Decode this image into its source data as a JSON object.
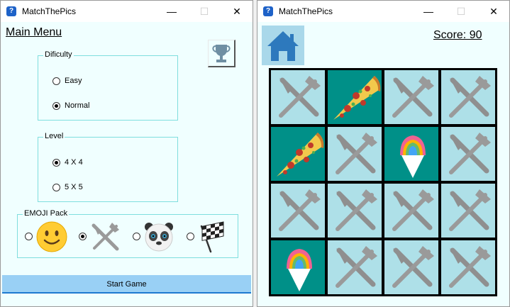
{
  "left_window": {
    "title": "MatchThePics",
    "app_icon_glyph": "?",
    "main_menu_label": "Main Menu",
    "difficulty": {
      "legend": "Dificulty",
      "options": [
        {
          "label": "Easy",
          "checked": false
        },
        {
          "label": "Normal",
          "checked": true
        }
      ]
    },
    "level": {
      "legend": "Level",
      "options": [
        {
          "label": "4 X 4",
          "checked": true
        },
        {
          "label": "5 X 5",
          "checked": false
        }
      ]
    },
    "emoji_pack": {
      "legend": "EMOJI Pack",
      "options": [
        {
          "icon": "smiley-face-icon",
          "checked": false
        },
        {
          "icon": "fork-knife-icon",
          "checked": true
        },
        {
          "icon": "panda-icon",
          "checked": false
        },
        {
          "icon": "checkered-flag-icon",
          "checked": false
        }
      ]
    },
    "start_button_label": "Start Game",
    "colors": {
      "accent": "#99d0f5",
      "background": "#f0ffff",
      "group_border": "#7fdede"
    }
  },
  "right_window": {
    "title": "MatchThePics",
    "score_text": "Score: 90",
    "board": {
      "rows": 4,
      "cols": 4,
      "tiles": [
        "hidden",
        "pizza",
        "hidden",
        "hidden",
        "pizza",
        "hidden",
        "shaved-ice",
        "hidden",
        "hidden",
        "hidden",
        "hidden",
        "hidden",
        "shaved-ice",
        "hidden",
        "hidden",
        "hidden"
      ]
    },
    "colors": {
      "tile_hidden": "#aee0e8",
      "tile_revealed": "#009088",
      "home_button": "#a9d8ea"
    }
  },
  "window_controls": {
    "minimize": "—",
    "maximize": "☐",
    "close": "✕"
  }
}
